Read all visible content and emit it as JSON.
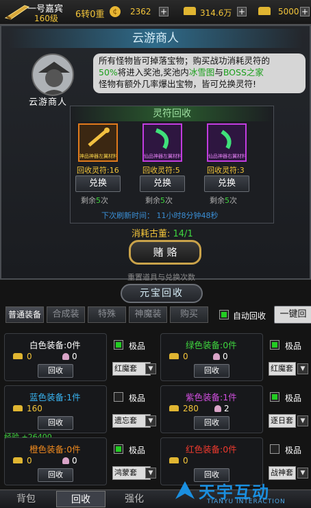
{
  "topbar": {
    "player_name": "一号嘉宾",
    "level": "160级",
    "rebirth": "6转0重",
    "gold": "2362",
    "ingot": "314.6万",
    "bound_gold": "5000"
  },
  "merchant": {
    "title": "云游商人",
    "npc_label": "云游商人",
    "desc_line1": "所有怪物皆可掉落宝物；购买战功消耗灵符的",
    "desc_pct": "50%",
    "desc_mid1": "将进入奖池,奖池内",
    "desc_map1": "冰雪图",
    "desc_and": "与",
    "desc_map2": "BOSS之家",
    "desc_line3": "怪物有额外几率爆出宝物，皆可兑换灵符!",
    "recycle_title": "灵符回收",
    "items": [
      {
        "name": "神品神器左翼材料",
        "reward": "回收灵符:16",
        "btn": "兑换",
        "remain_pre": "剩余",
        "remain_num": "5",
        "remain_suf": "次",
        "color": "#e07a1c"
      },
      {
        "name": "仙品神器左翼材料",
        "reward": "回收灵符:5",
        "btn": "兑换",
        "remain_pre": "剩余",
        "remain_num": "5",
        "remain_suf": "次",
        "color": "#c23ce0"
      },
      {
        "name": "仙品神器右翼材料",
        "reward": "回收灵符:3",
        "btn": "兑换",
        "remain_pre": "剩余",
        "remain_num": "5",
        "remain_suf": "次",
        "color": "#c23ce0"
      }
    ],
    "refresh": "下次刷新时间：  11小时8分钟48秒",
    "cost_label": "消耗古董: ",
    "cost_value": "14/1",
    "gamble_btn": "赌 赂",
    "reset_hint": "重置道具与兑换次数"
  },
  "recycle": {
    "title": "元宝回收",
    "tabs": [
      "普通装备",
      "合成装",
      "特殊",
      "神魔装",
      "购买"
    ],
    "auto_label": "自动回收",
    "onekey_btn": "一键回",
    "quality_label": "极品",
    "recycle_btn": "回收",
    "slots": [
      {
        "label": "白色装备:0件",
        "color": "#ffffff",
        "gold": "0",
        "shell": "0",
        "checked": true,
        "set": "红魔套"
      },
      {
        "label": "绿色装备:0件",
        "color": "#3fd63f",
        "gold": "0",
        "shell": "0",
        "checked": true,
        "set": "红魔套"
      },
      {
        "label": "蓝色装备:1件",
        "color": "#39b5f2",
        "gold": "160",
        "shell": "",
        "checked": false,
        "set": "遗忘套"
      },
      {
        "label": "紫色装备:1件",
        "color": "#d24fe0",
        "gold": "280",
        "shell": "2",
        "checked": true,
        "set": "逐日套"
      },
      {
        "label": "橙色装备:0件",
        "color": "#f08a1e",
        "gold": "0",
        "shell": "0",
        "checked": true,
        "set": "鸿蒙套"
      },
      {
        "label": "红色装备:0件",
        "color": "#f03a2e",
        "gold": "0",
        "shell": "",
        "checked": false,
        "set": "战神套"
      }
    ],
    "exp_gain": "经验 +26400"
  },
  "bottom_nav": [
    "背包",
    "回收",
    "强化"
  ],
  "watermark": "天宇互动",
  "watermark_sub": "TIANYU INTERACTION"
}
